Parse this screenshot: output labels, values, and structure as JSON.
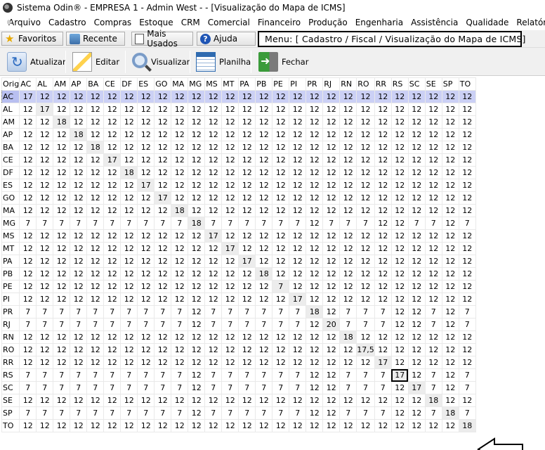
{
  "window": {
    "title": "Sistema Odin® - EMPRESA 1 - Admin West -  - [Visualização do Mapa de ICMS]"
  },
  "menu": [
    "Arquivo",
    "Cadastro",
    "Compras",
    "Estoque",
    "CRM",
    "Comercial",
    "Financeiro",
    "Produção",
    "Engenharia",
    "Assistência",
    "Qualidade",
    "Relatórios"
  ],
  "favbar": {
    "favoritos": "Favoritos",
    "recente": "Recente",
    "mais_usados": "Mais Usados",
    "ajuda": "Ajuda",
    "menu_path": "Menu: [ Cadastro / Fiscal / Visualização do Mapa de ICMS]"
  },
  "toolbar": {
    "atualizar": "Atualizar",
    "editar": "Editar",
    "visualizar": "Visualizar",
    "planilha": "Planilha",
    "fechar": "Fechar"
  },
  "grid": {
    "corner": "Orig",
    "states": [
      "AC",
      "AL",
      "AM",
      "AP",
      "BA",
      "CE",
      "DF",
      "ES",
      "GO",
      "MA",
      "MG",
      "MS",
      "MT",
      "PA",
      "PB",
      "PE",
      "PI",
      "PR",
      "RJ",
      "RN",
      "RO",
      "RR",
      "RS",
      "SC",
      "SE",
      "SP",
      "TO"
    ],
    "selected_row": 0,
    "highlighted_cell": {
      "row": "RS",
      "col": "RS"
    },
    "rows": [
      [
        "17",
        "12",
        "12",
        "12",
        "12",
        "12",
        "12",
        "12",
        "12",
        "12",
        "12",
        "12",
        "12",
        "12",
        "12",
        "12",
        "12",
        "12",
        "12",
        "12",
        "12",
        "12",
        "12",
        "12",
        "12",
        "12",
        "12"
      ],
      [
        "12",
        "17",
        "12",
        "12",
        "12",
        "12",
        "12",
        "12",
        "12",
        "12",
        "12",
        "12",
        "12",
        "12",
        "12",
        "12",
        "12",
        "12",
        "12",
        "12",
        "12",
        "12",
        "12",
        "12",
        "12",
        "12",
        "12"
      ],
      [
        "12",
        "12",
        "18",
        "12",
        "12",
        "12",
        "12",
        "12",
        "12",
        "12",
        "12",
        "12",
        "12",
        "12",
        "12",
        "12",
        "12",
        "12",
        "12",
        "12",
        "12",
        "12",
        "12",
        "12",
        "12",
        "12",
        "12"
      ],
      [
        "12",
        "12",
        "12",
        "18",
        "12",
        "12",
        "12",
        "12",
        "12",
        "12",
        "12",
        "12",
        "12",
        "12",
        "12",
        "12",
        "12",
        "12",
        "12",
        "12",
        "12",
        "12",
        "12",
        "12",
        "12",
        "12",
        "12"
      ],
      [
        "12",
        "12",
        "12",
        "12",
        "18",
        "12",
        "12",
        "12",
        "12",
        "12",
        "12",
        "12",
        "12",
        "12",
        "12",
        "12",
        "12",
        "12",
        "12",
        "12",
        "12",
        "12",
        "12",
        "12",
        "12",
        "12",
        "12"
      ],
      [
        "12",
        "12",
        "12",
        "12",
        "12",
        "17",
        "12",
        "12",
        "12",
        "12",
        "12",
        "12",
        "12",
        "12",
        "12",
        "12",
        "12",
        "12",
        "12",
        "12",
        "12",
        "12",
        "12",
        "12",
        "12",
        "12",
        "12"
      ],
      [
        "12",
        "12",
        "12",
        "12",
        "12",
        "12",
        "18",
        "12",
        "12",
        "12",
        "12",
        "12",
        "12",
        "12",
        "12",
        "12",
        "12",
        "12",
        "12",
        "12",
        "12",
        "12",
        "12",
        "12",
        "12",
        "12",
        "12"
      ],
      [
        "12",
        "12",
        "12",
        "12",
        "12",
        "12",
        "12",
        "17",
        "12",
        "12",
        "12",
        "12",
        "12",
        "12",
        "12",
        "12",
        "12",
        "12",
        "12",
        "12",
        "12",
        "12",
        "12",
        "12",
        "12",
        "12",
        "12"
      ],
      [
        "12",
        "12",
        "12",
        "12",
        "12",
        "12",
        "12",
        "12",
        "17",
        "12",
        "12",
        "12",
        "12",
        "12",
        "12",
        "12",
        "12",
        "12",
        "12",
        "12",
        "12",
        "12",
        "12",
        "12",
        "12",
        "12",
        "12"
      ],
      [
        "12",
        "12",
        "12",
        "12",
        "12",
        "12",
        "12",
        "12",
        "12",
        "18",
        "12",
        "12",
        "12",
        "12",
        "12",
        "12",
        "12",
        "12",
        "12",
        "12",
        "12",
        "12",
        "12",
        "12",
        "12",
        "12",
        "12"
      ],
      [
        "7",
        "7",
        "7",
        "7",
        "7",
        "7",
        "7",
        "7",
        "7",
        "7",
        "18",
        "7",
        "7",
        "7",
        "7",
        "7",
        "7",
        "12",
        "7",
        "7",
        "7",
        "12",
        "12",
        "7",
        "7",
        "12",
        "7"
      ],
      [
        "12",
        "12",
        "12",
        "12",
        "12",
        "12",
        "12",
        "12",
        "12",
        "12",
        "12",
        "17",
        "12",
        "12",
        "12",
        "12",
        "12",
        "12",
        "12",
        "12",
        "12",
        "12",
        "12",
        "12",
        "12",
        "12",
        "12"
      ],
      [
        "12",
        "12",
        "12",
        "12",
        "12",
        "12",
        "12",
        "12",
        "12",
        "12",
        "12",
        "12",
        "17",
        "12",
        "12",
        "12",
        "12",
        "12",
        "12",
        "12",
        "12",
        "12",
        "12",
        "12",
        "12",
        "12",
        "12"
      ],
      [
        "12",
        "12",
        "12",
        "12",
        "12",
        "12",
        "12",
        "12",
        "12",
        "12",
        "12",
        "12",
        "12",
        "17",
        "12",
        "12",
        "12",
        "12",
        "12",
        "12",
        "12",
        "12",
        "12",
        "12",
        "12",
        "12",
        "12"
      ],
      [
        "12",
        "12",
        "12",
        "12",
        "12",
        "12",
        "12",
        "12",
        "12",
        "12",
        "12",
        "12",
        "12",
        "12",
        "18",
        "12",
        "12",
        "12",
        "12",
        "12",
        "12",
        "12",
        "12",
        "12",
        "12",
        "12",
        "12"
      ],
      [
        "12",
        "12",
        "12",
        "12",
        "12",
        "12",
        "12",
        "12",
        "12",
        "12",
        "12",
        "12",
        "12",
        "12",
        "12",
        "7",
        "12",
        "12",
        "12",
        "12",
        "12",
        "12",
        "12",
        "12",
        "12",
        "12",
        "12"
      ],
      [
        "12",
        "12",
        "12",
        "12",
        "12",
        "12",
        "12",
        "12",
        "12",
        "12",
        "12",
        "12",
        "12",
        "12",
        "12",
        "12",
        "17",
        "12",
        "12",
        "12",
        "12",
        "12",
        "12",
        "12",
        "12",
        "12",
        "12"
      ],
      [
        "7",
        "7",
        "7",
        "7",
        "7",
        "7",
        "7",
        "7",
        "7",
        "7",
        "12",
        "7",
        "7",
        "7",
        "7",
        "7",
        "7",
        "18",
        "12",
        "7",
        "7",
        "7",
        "12",
        "12",
        "7",
        "12",
        "7"
      ],
      [
        "7",
        "7",
        "7",
        "7",
        "7",
        "7",
        "7",
        "7",
        "7",
        "7",
        "12",
        "7",
        "7",
        "7",
        "7",
        "7",
        "7",
        "12",
        "20",
        "7",
        "7",
        "7",
        "12",
        "12",
        "7",
        "12",
        "7"
      ],
      [
        "12",
        "12",
        "12",
        "12",
        "12",
        "12",
        "12",
        "12",
        "12",
        "12",
        "12",
        "12",
        "12",
        "12",
        "12",
        "12",
        "12",
        "12",
        "12",
        "18",
        "12",
        "12",
        "12",
        "12",
        "12",
        "12",
        "12"
      ],
      [
        "12",
        "12",
        "12",
        "12",
        "12",
        "12",
        "12",
        "12",
        "12",
        "12",
        "12",
        "12",
        "12",
        "12",
        "12",
        "12",
        "12",
        "12",
        "12",
        "12",
        "17,5",
        "12",
        "12",
        "12",
        "12",
        "12",
        "12"
      ],
      [
        "12",
        "12",
        "12",
        "12",
        "12",
        "12",
        "12",
        "12",
        "12",
        "12",
        "12",
        "12",
        "12",
        "12",
        "12",
        "12",
        "12",
        "12",
        "12",
        "12",
        "12",
        "17",
        "12",
        "12",
        "12",
        "12",
        "12"
      ],
      [
        "7",
        "7",
        "7",
        "7",
        "7",
        "7",
        "7",
        "7",
        "7",
        "7",
        "12",
        "7",
        "7",
        "7",
        "7",
        "7",
        "7",
        "12",
        "12",
        "7",
        "7",
        "7",
        "17",
        "12",
        "7",
        "12",
        "7"
      ],
      [
        "7",
        "7",
        "7",
        "7",
        "7",
        "7",
        "7",
        "7",
        "7",
        "7",
        "12",
        "7",
        "7",
        "7",
        "7",
        "7",
        "7",
        "12",
        "12",
        "7",
        "7",
        "7",
        "12",
        "17",
        "7",
        "12",
        "7"
      ],
      [
        "12",
        "12",
        "12",
        "12",
        "12",
        "12",
        "12",
        "12",
        "12",
        "12",
        "12",
        "12",
        "12",
        "12",
        "12",
        "12",
        "12",
        "12",
        "12",
        "12",
        "12",
        "12",
        "12",
        "12",
        "18",
        "12",
        "12"
      ],
      [
        "7",
        "7",
        "7",
        "7",
        "7",
        "7",
        "7",
        "7",
        "7",
        "7",
        "12",
        "7",
        "7",
        "7",
        "7",
        "7",
        "7",
        "12",
        "12",
        "7",
        "7",
        "7",
        "12",
        "12",
        "7",
        "18",
        "7"
      ],
      [
        "12",
        "12",
        "12",
        "12",
        "12",
        "12",
        "12",
        "12",
        "12",
        "12",
        "12",
        "12",
        "12",
        "12",
        "12",
        "12",
        "12",
        "12",
        "12",
        "12",
        "12",
        "12",
        "12",
        "12",
        "12",
        "12",
        "18"
      ]
    ]
  }
}
